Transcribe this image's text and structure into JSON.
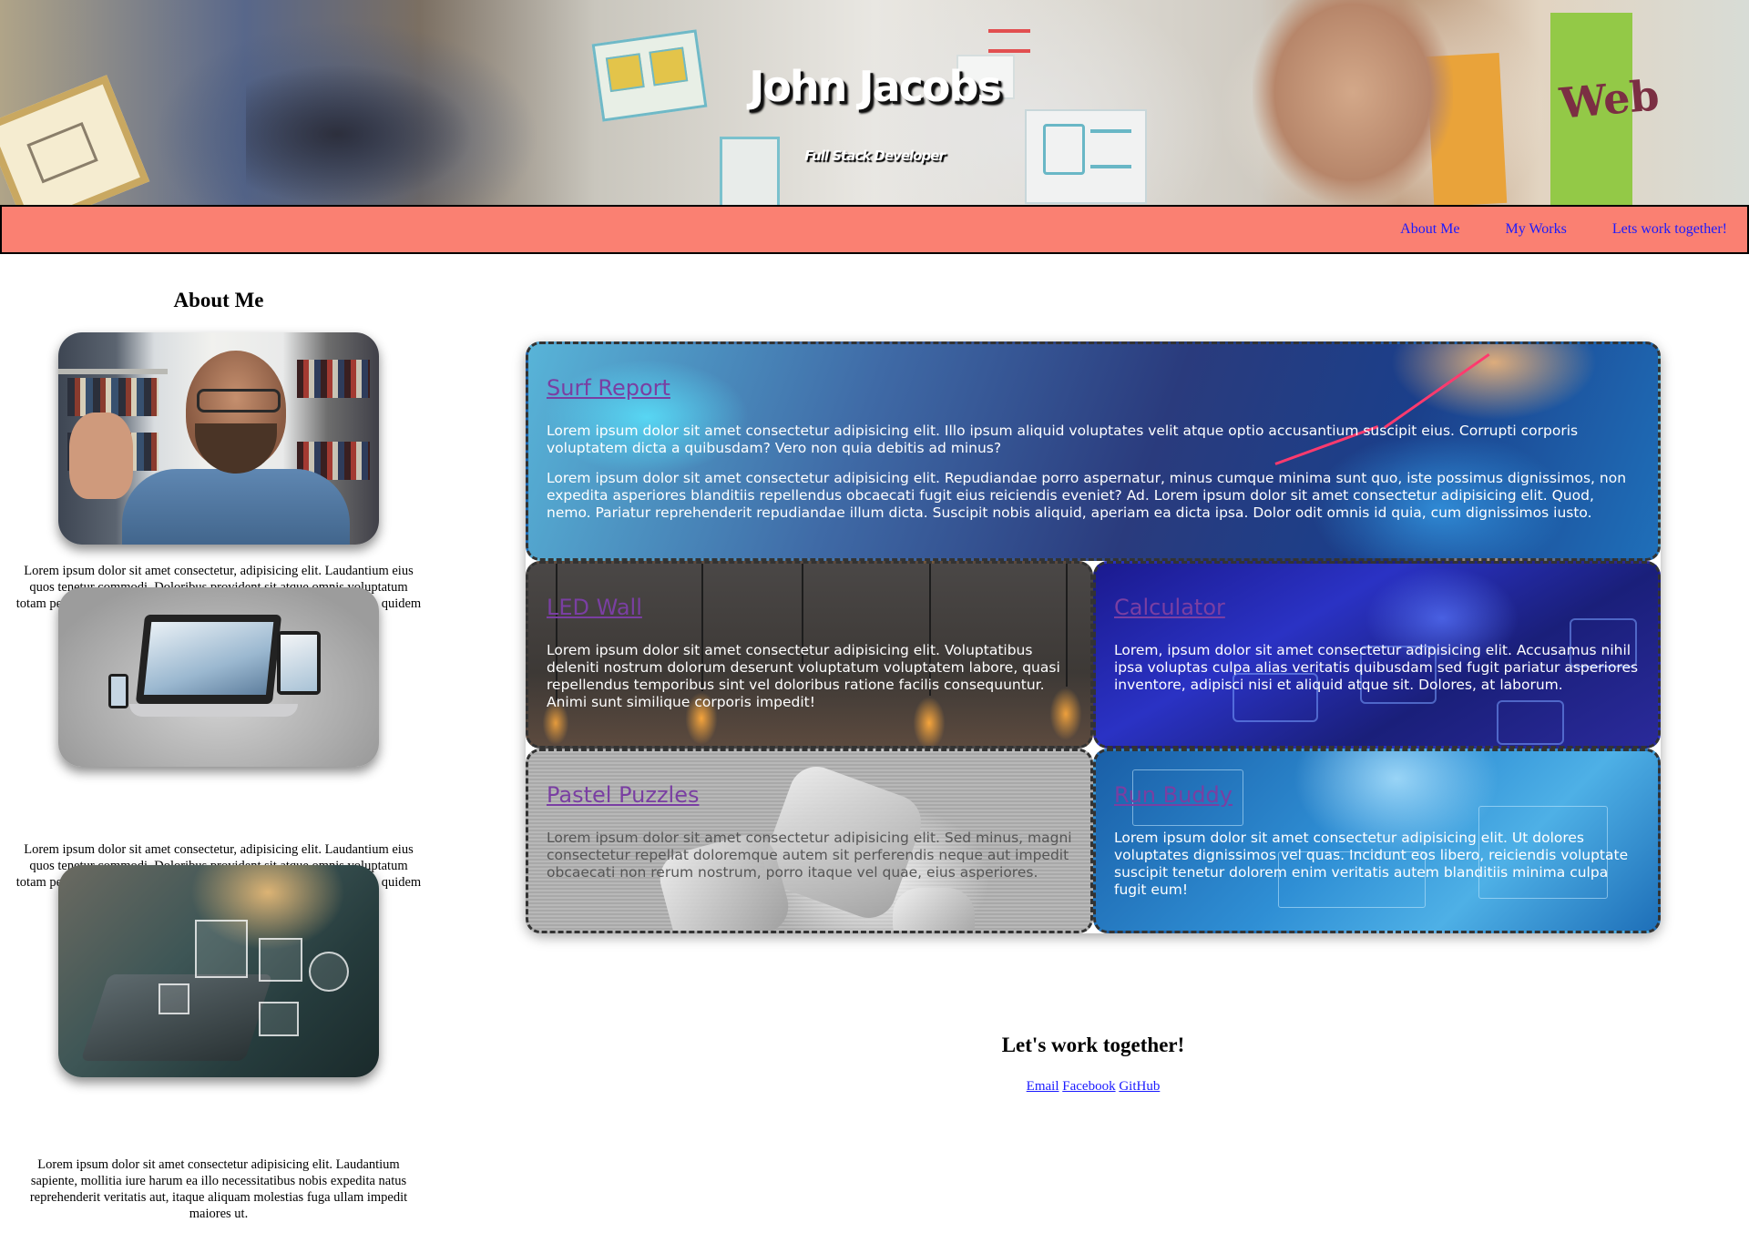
{
  "hero": {
    "title": "John Jacobs",
    "subtitle": "Full Stack Developer",
    "sticky_note_text": "Web"
  },
  "nav": {
    "items": [
      {
        "label": "About Me"
      },
      {
        "label": "My Works"
      },
      {
        "label": "Lets work together!"
      }
    ]
  },
  "about": {
    "heading": "About Me",
    "blocks": [
      {
        "image": "portrait-photo",
        "text": "Lorem ipsum dolor sit amet consectetur, adipisicing elit. Laudantium eius quos tenetur commodi. Doloribus provident sit atque omnis voluptatum totam perspiciatis, obcaecati recusandae. Tempore velit, tenetur fuga quidem asperiores consectetur."
      },
      {
        "image": "responsive-devices-photo",
        "text": "Lorem ipsum dolor sit amet consectetur, adipisicing elit. Laudantium eius quos tenetur commodi. Doloribus provident sit atque omnis voluptatum totam perspiciatis, obcaecati recusandae. Tempore velit, tenetur fuga quidem asperiores consectetur."
      },
      {
        "image": "laptop-icons-photo",
        "text": "Lorem ipsum dolor sit amet consectetur adipisicing elit. Laudantium sapiente, mollitia iure harum ea illo necessitatibus nobis expedita natus reprehenderit veritatis aut, itaque aliquam molestias fuga ullam impedit maiores ut."
      }
    ]
  },
  "works": [
    {
      "title": "Surf Report",
      "paragraphs": [
        "Lorem ipsum dolor sit amet consectetur adipisicing elit. Illo ipsum aliquid voluptates velit atque optio accusantium suscipit eius. Corrupti corporis voluptatem dicta a quibusdam? Vero non quia debitis ad minus?",
        "Lorem ipsum dolor sit amet consectetur adipisicing elit. Repudiandae porro aspernatur, minus cumque minima sunt quo, iste possimus dignissimos, non expedita asperiores blanditiis repellendus obcaecati fugit eius reiciendis eveniet? Ad. Lorem ipsum dolor sit amet consectetur adipisicing elit. Quod, nemo. Pariatur reprehenderit repudiandae illum dicta. Suscipit nobis aliquid, aperiam ea dicta ipsa. Dolor odit omnis id quia, cum dignissimos iusto."
      ]
    },
    {
      "title": "LED Wall",
      "paragraphs": [
        "Lorem ipsum dolor sit amet consectetur adipisicing elit. Voluptatibus deleniti nostrum dolorum deserunt voluptatum voluptatem labore, quasi repellendus temporibus sint vel doloribus ratione facilis consequuntur. Animi sunt similique corporis impedit!"
      ]
    },
    {
      "title": "Calculator",
      "paragraphs": [
        "Lorem, ipsum dolor sit amet consectetur adipisicing elit. Accusamus nihil ipsa voluptas culpa alias veritatis quibusdam sed fugit pariatur asperiores inventore, adipisci nisi et aliquid atque sit. Dolores, at laborum."
      ]
    },
    {
      "title": "Pastel Puzzles",
      "paragraphs": [
        "Lorem ipsum dolor sit amet consectetur adipisicing elit. Sed minus, magni consectetur repellat doloremque autem sit perferendis neque aut impedit obcaecati non rerum nostrum, porro itaque vel quae, eius asperiores."
      ]
    },
    {
      "title": "Run Buddy",
      "paragraphs": [
        "Lorem ipsum dolor sit amet consectetur adipisicing elit. Ut dolores voluptates dignissimos vel quas. Incidunt eos libero, reiciendis voluptate suscipit tenetur dolorem enim veritatis autem blanditiis minima culpa fugit eum!"
      ]
    }
  ],
  "contact": {
    "heading": "Let's work together!",
    "links": [
      {
        "label": "Email"
      },
      {
        "label": "Facebook"
      },
      {
        "label": "GitHub"
      }
    ]
  }
}
